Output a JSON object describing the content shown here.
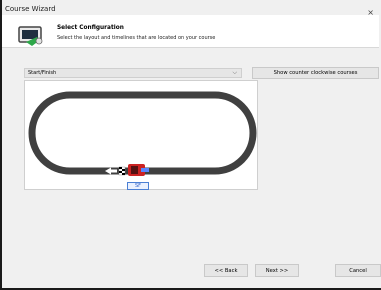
{
  "window": {
    "title": "Course Wizard",
    "close_glyph": "×"
  },
  "header": {
    "title": "Select Configuration",
    "subtitle": "Select the layout and timelines that are located on your course",
    "icon": "wizard-icon"
  },
  "layout_select": {
    "selected": "Start/Finish",
    "arrow_glyph": "⌵"
  },
  "ccw_button": {
    "label": "Show counter clockwise courses"
  },
  "preview": {
    "timeline_label": "SF",
    "colors": {
      "track": "#404040",
      "car": "#cc2222",
      "timeline": "#4a7fd4"
    }
  },
  "footer": {
    "back_label": "<< Back",
    "next_label": "Next >>",
    "cancel_label": "Cancel"
  }
}
